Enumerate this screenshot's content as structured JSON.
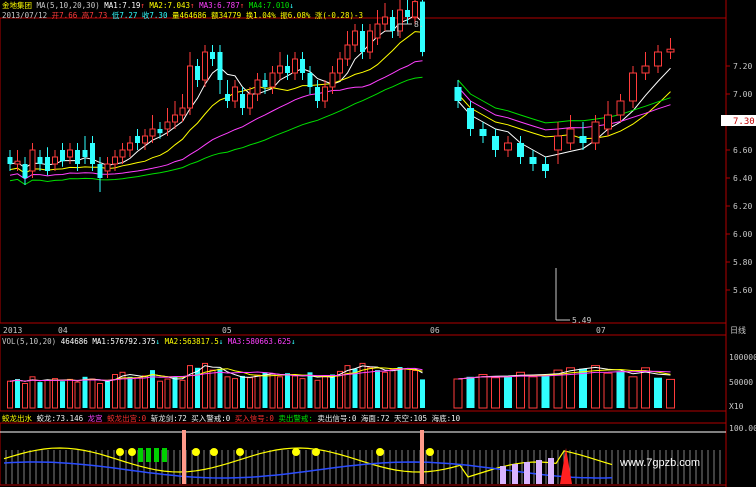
{
  "header": {
    "title": "金地集团",
    "ma_set": "MA(5,10,20,30)",
    "ma1": "MA1:7.19",
    "ma2": "MA2:7.043",
    "ma3": "MA3:6.787",
    "ma4": "MA4:7.010",
    "ma_up_arrow": "↑",
    "ma_down_arrow": "↓"
  },
  "ohlc": {
    "date": "2013/07/12",
    "open": "开7.66",
    "high": "高7.73",
    "low": "低7.27",
    "close": "收7.30",
    "volume": "量464686",
    "amount": "额34779",
    "turnover": "换1.04%",
    "amplitude": "振6.08%",
    "change": "涨(-0.28)-3"
  },
  "price_badge": "7.30",
  "price_axis": [
    "7.20",
    "7.00",
    "6.80",
    "6.60",
    "6.40",
    "6.20",
    "6.00",
    "5.80",
    "5.60"
  ],
  "date_axis": {
    "year": "2013",
    "months": [
      "04",
      "05",
      "06",
      "07"
    ],
    "period": "日线"
  },
  "annotations": {
    "high": "8.",
    "low": "5.49"
  },
  "volume_panel": {
    "title": "VOL(5,10,20)",
    "vol": "464686",
    "ma1": "MA1:576792.375",
    "ma2": "MA2:563817.5",
    "ma3": "MA3:580663.625",
    "axis": [
      "100000",
      "50000"
    ],
    "unit": "X10"
  },
  "indicator_panel": {
    "name": "蛟龙出水",
    "items": [
      {
        "text": "蛟龙:73.146",
        "color": "#f0f0f0"
      },
      {
        "text": "龙宫",
        "color": "#ff40ff"
      },
      {
        "text": "蛟龙出宫:0",
        "color": "#ff3030"
      },
      {
        "text": "斩龙剑:72",
        "color": "#f0f0f0"
      },
      {
        "text": "买入警戒:0",
        "color": "#f0f0f0"
      },
      {
        "text": "买入信号:0",
        "color": "#ff3030"
      },
      {
        "text": "卖出警戒:",
        "color": "#00e000"
      },
      {
        "text": "卖出信号:0",
        "color": "#f0f0f0"
      },
      {
        "text": "海面:72",
        "color": "#f0f0f0"
      },
      {
        "text": "天空:105",
        "color": "#f0f0f0"
      },
      {
        "text": "海底:10",
        "color": "#f0f0f0"
      }
    ],
    "axis": [
      "100.00"
    ],
    "watermark": "www.7gpzb.com"
  },
  "colors": {
    "up": "#ff3c3c",
    "down": "#30ffff",
    "ma1": "#ffffff",
    "ma2": "#ffff00",
    "ma3": "#ff40ff",
    "ma4": "#00e000"
  },
  "chart_data": {
    "type": "candlestick",
    "ylim": [
      5.4,
      7.5
    ],
    "candles": [
      [
        6.55,
        6.5,
        6.6,
        6.45
      ],
      [
        6.5,
        6.52,
        6.6,
        6.45
      ],
      [
        6.5,
        6.4,
        6.55,
        6.35
      ],
      [
        6.45,
        6.6,
        6.65,
        6.4
      ],
      [
        6.55,
        6.5,
        6.6,
        6.45
      ],
      [
        6.55,
        6.45,
        6.62,
        6.42
      ],
      [
        6.5,
        6.55,
        6.6,
        6.45
      ],
      [
        6.6,
        6.52,
        6.65,
        6.48
      ],
      [
        6.55,
        6.6,
        6.65,
        6.5
      ],
      [
        6.6,
        6.5,
        6.65,
        6.45
      ],
      [
        6.6,
        6.55,
        6.7,
        6.5
      ],
      [
        6.65,
        6.5,
        6.7,
        6.45
      ],
      [
        6.5,
        6.4,
        6.55,
        6.3
      ],
      [
        6.45,
        6.5,
        6.55,
        6.4
      ],
      [
        6.5,
        6.55,
        6.6,
        6.45
      ],
      [
        6.55,
        6.6,
        6.65,
        6.5
      ],
      [
        6.6,
        6.65,
        6.7,
        6.55
      ],
      [
        6.7,
        6.65,
        6.75,
        6.6
      ],
      [
        6.65,
        6.7,
        6.75,
        6.6
      ],
      [
        6.7,
        6.75,
        6.85,
        6.65
      ],
      [
        6.75,
        6.72,
        6.8,
        6.68
      ],
      [
        6.75,
        6.8,
        6.9,
        6.7
      ],
      [
        6.8,
        6.85,
        6.95,
        6.75
      ],
      [
        6.85,
        6.9,
        7.0,
        6.8
      ],
      [
        6.9,
        7.2,
        7.3,
        6.85
      ],
      [
        7.2,
        7.1,
        7.25,
        7.05
      ],
      [
        7.1,
        7.3,
        7.35,
        7.05
      ],
      [
        7.3,
        7.25,
        7.35,
        7.2
      ],
      [
        7.3,
        7.1,
        7.35,
        7.0
      ],
      [
        7.0,
        6.95,
        7.1,
        6.9
      ],
      [
        6.95,
        7.05,
        7.1,
        6.9
      ],
      [
        7.0,
        6.9,
        7.05,
        6.85
      ],
      [
        6.9,
        7.0,
        7.05,
        6.85
      ],
      [
        7.0,
        7.1,
        7.15,
        6.95
      ],
      [
        7.1,
        7.05,
        7.15,
        7.0
      ],
      [
        7.05,
        7.15,
        7.2,
        7.0
      ],
      [
        7.15,
        7.2,
        7.3,
        7.1
      ],
      [
        7.2,
        7.15,
        7.28,
        7.1
      ],
      [
        7.15,
        7.25,
        7.3,
        7.1
      ],
      [
        7.25,
        7.15,
        7.3,
        7.1
      ],
      [
        7.15,
        7.05,
        7.2,
        7.0
      ],
      [
        7.05,
        6.95,
        7.1,
        6.9
      ],
      [
        6.95,
        7.05,
        7.1,
        6.9
      ],
      [
        7.05,
        7.15,
        7.2,
        7.0
      ],
      [
        7.15,
        7.25,
        7.3,
        7.1
      ],
      [
        7.25,
        7.35,
        7.45,
        7.2
      ],
      [
        7.35,
        7.45,
        7.5,
        7.3
      ],
      [
        7.45,
        7.3,
        7.5,
        7.25
      ],
      [
        7.3,
        7.45,
        7.5,
        7.25
      ],
      [
        7.4,
        7.5,
        7.6,
        7.35
      ],
      [
        7.5,
        7.55,
        7.65,
        7.45
      ],
      [
        7.55,
        7.45,
        7.6,
        7.4
      ],
      [
        7.45,
        7.6,
        7.7,
        7.4
      ],
      [
        7.6,
        7.55,
        7.7,
        7.5
      ],
      [
        7.55,
        7.66,
        7.75,
        7.5
      ],
      [
        7.66,
        7.3,
        7.73,
        7.27
      ]
    ],
    "candles_right": [
      [
        7.05,
        6.95,
        7.1,
        6.9
      ],
      [
        6.9,
        6.75,
        6.95,
        6.7
      ],
      [
        6.75,
        6.7,
        6.8,
        6.65
      ],
      [
        6.7,
        6.6,
        6.75,
        6.55
      ],
      [
        6.6,
        6.65,
        6.7,
        6.55
      ],
      [
        6.65,
        6.55,
        6.7,
        6.5
      ],
      [
        6.55,
        6.5,
        6.6,
        6.45
      ],
      [
        6.5,
        6.45,
        6.55,
        6.4
      ],
      [
        6.6,
        6.7,
        6.8,
        6.5
      ],
      [
        6.65,
        6.75,
        6.85,
        6.6
      ],
      [
        6.7,
        6.65,
        6.8,
        6.6
      ],
      [
        6.65,
        6.8,
        6.85,
        6.6
      ],
      [
        6.75,
        6.85,
        6.95,
        6.7
      ],
      [
        6.85,
        6.95,
        7.0,
        6.8
      ],
      [
        6.95,
        7.15,
        7.2,
        6.9
      ],
      [
        7.15,
        7.2,
        7.3,
        7.1
      ],
      [
        7.2,
        7.3,
        7.35,
        7.15
      ],
      [
        7.3,
        7.32,
        7.4,
        7.25
      ]
    ],
    "volume": [
      60,
      65,
      55,
      70,
      58,
      62,
      66,
      60,
      64,
      58,
      70,
      65,
      55,
      60,
      75,
      80,
      70,
      68,
      72,
      85,
      60,
      65,
      70,
      62,
      95,
      90,
      100,
      85,
      88,
      70,
      66,
      72,
      68,
      74,
      80,
      76,
      70,
      78,
      72,
      66,
      80,
      62,
      70,
      75,
      82,
      95,
      88,
      100,
      90,
      85,
      80,
      86,
      92,
      88,
      84,
      64
    ],
    "volume_right": [
      65,
      70,
      75,
      68,
      72,
      80,
      70,
      75,
      85,
      90,
      88,
      95,
      78,
      82,
      70,
      90,
      68,
      64
    ],
    "volume_ylim": [
      0,
      130
    ]
  }
}
